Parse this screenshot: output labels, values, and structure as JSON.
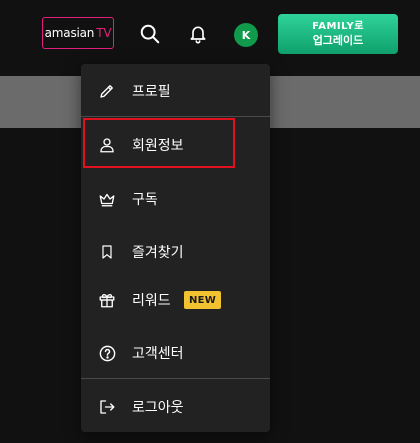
{
  "header": {
    "logo_text": "amasian",
    "logo_suffix": "TV",
    "avatar_initial": "K",
    "upgrade_line1": "FAMILY로",
    "upgrade_line2": "업그레이드"
  },
  "menu": {
    "items": [
      {
        "label": "프로필",
        "icon": "pencil-icon"
      },
      {
        "label": "회원정보",
        "icon": "user-icon"
      },
      {
        "label": "구독",
        "icon": "crown-icon"
      },
      {
        "label": "즐겨찾기",
        "icon": "bookmark-icon"
      },
      {
        "label": "리워드",
        "icon": "gift-icon",
        "badge": "NEW"
      },
      {
        "label": "고객센터",
        "icon": "help-circle-icon"
      },
      {
        "label": "로그아웃",
        "icon": "logout-icon"
      }
    ]
  },
  "colors": {
    "accent_green": "#1fbf85",
    "logo_pink": "#e0207a",
    "highlight_red": "#e0101e",
    "badge_yellow": "#f2c230"
  }
}
